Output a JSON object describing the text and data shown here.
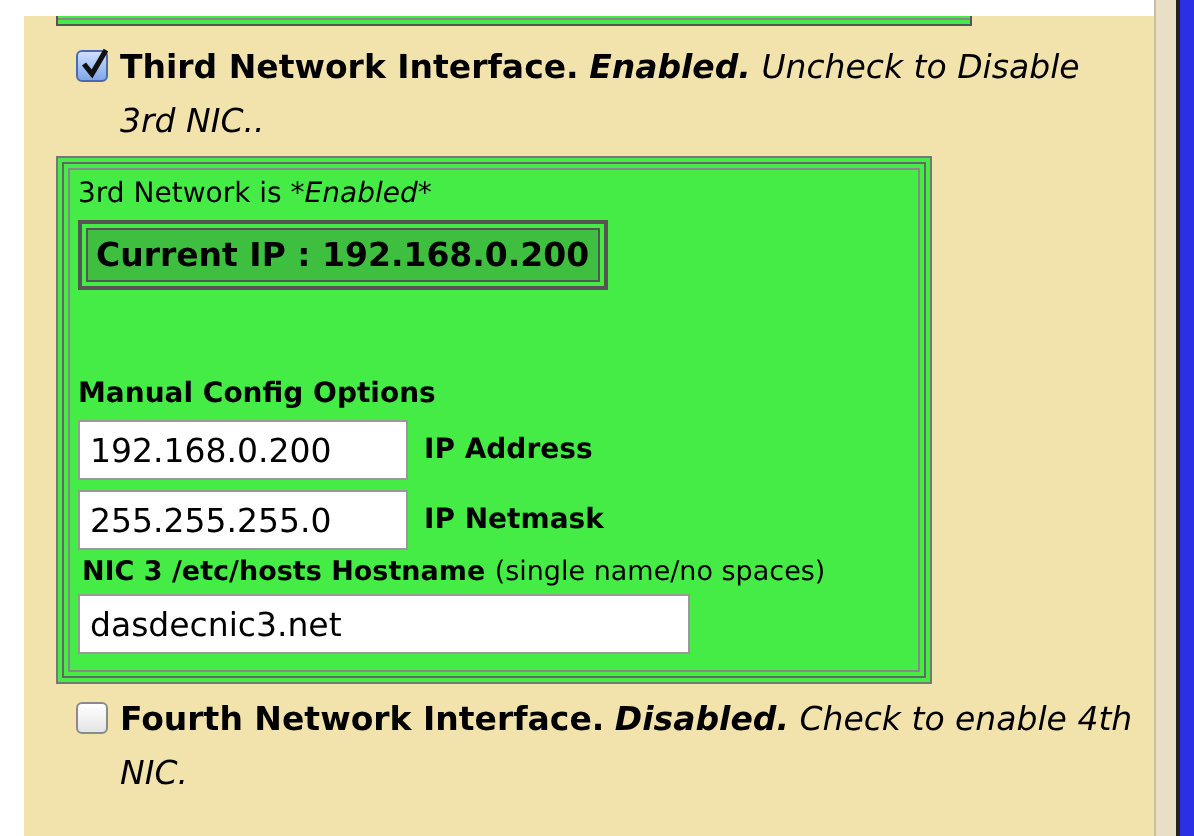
{
  "nics": [
    {
      "checked": true,
      "title": "Third Network Interface.",
      "status": "Enabled.",
      "hint": "Uncheck to Disable 3rd NIC..",
      "panel": {
        "status_text": "3rd Network is",
        "status_value": "*Enabled*",
        "current_ip": "Current IP : 192.168.0.200",
        "manual_heading": "Manual Config Options",
        "fields": [
          {
            "value": "192.168.0.200",
            "label": "IP Address"
          },
          {
            "value": "255.255.255.0",
            "label": "IP Netmask"
          }
        ],
        "hostname_label": "NIC 3 /etc/hosts Hostname",
        "hostname_hint": "(single name/no spaces)",
        "hostname": "dasdecnic3.net"
      }
    },
    {
      "checked": false,
      "title": "Fourth Network Interface.",
      "status": "Disabled.",
      "hint": "Check to enable 4th NIC."
    }
  ]
}
